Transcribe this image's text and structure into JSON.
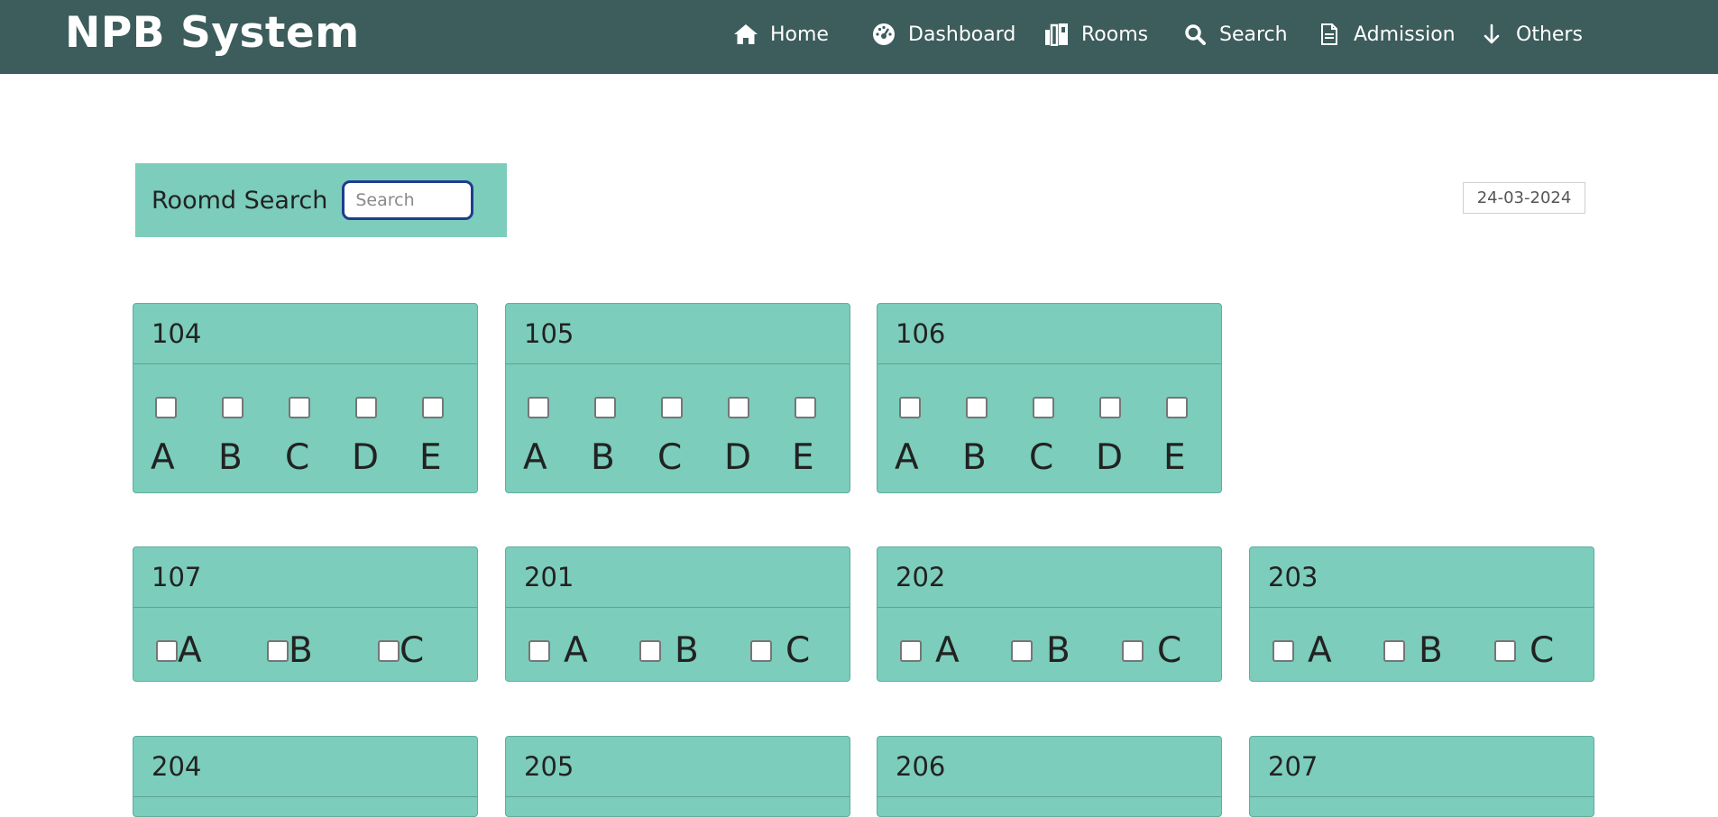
{
  "app": {
    "brand": "NPB System"
  },
  "nav": {
    "items": [
      {
        "label": "Home",
        "icon": "home-icon"
      },
      {
        "label": "Dashboard",
        "icon": "dashboard-icon"
      },
      {
        "label": "Rooms",
        "icon": "rooms-icon"
      },
      {
        "label": "Search",
        "icon": "search-icon"
      },
      {
        "label": "Admission",
        "icon": "document-icon"
      },
      {
        "label": "Others",
        "icon": "arrow-down-icon"
      }
    ]
  },
  "search": {
    "label": "Roomd Search",
    "placeholder": "Search",
    "value": ""
  },
  "date": "24-03-2024",
  "rooms": [
    {
      "number": "104",
      "beds": [
        "A",
        "B",
        "C",
        "D",
        "E"
      ]
    },
    {
      "number": "105",
      "beds": [
        "A",
        "B",
        "C",
        "D",
        "E"
      ]
    },
    {
      "number": "106",
      "beds": [
        "A",
        "B",
        "C",
        "D",
        "E"
      ]
    },
    {
      "number": "107",
      "beds": [
        "A",
        "B",
        "C"
      ]
    },
    {
      "number": "201",
      "beds": [
        "A",
        "B",
        "C"
      ]
    },
    {
      "number": "202",
      "beds": [
        "A",
        "B",
        "C"
      ]
    },
    {
      "number": "203",
      "beds": [
        "A",
        "B",
        "C"
      ]
    },
    {
      "number": "204"
    },
    {
      "number": "205"
    },
    {
      "number": "206"
    },
    {
      "number": "207"
    }
  ],
  "colors": {
    "navbar": "#3d5c5c",
    "card": "#7ccdbb",
    "focus_border": "#1f3c8f"
  }
}
